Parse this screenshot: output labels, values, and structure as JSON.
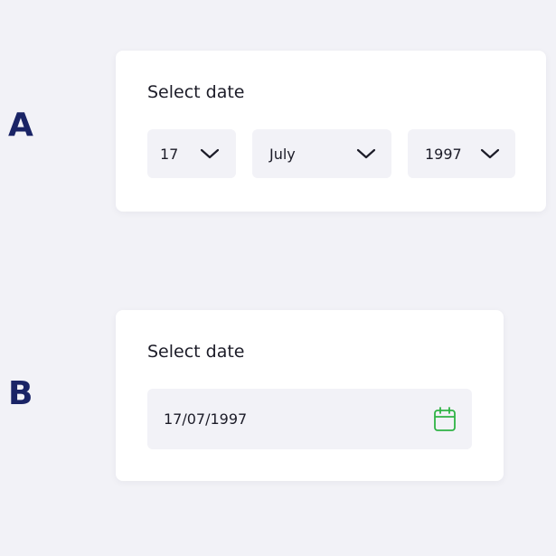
{
  "variants": {
    "a": {
      "letter": "A",
      "title": "Select date",
      "day": {
        "value": "17",
        "icon": "chevron-down-icon"
      },
      "month": {
        "value": "July",
        "icon": "chevron-down-icon"
      },
      "year": {
        "value": "1997",
        "icon": "chevron-down-icon"
      }
    },
    "b": {
      "letter": "B",
      "title": "Select date",
      "date_input": {
        "value": "17/07/1997",
        "icon": "calendar-icon"
      }
    }
  },
  "colors": {
    "background": "#f2f2f7",
    "card": "#ffffff",
    "letter": "#1a2466",
    "field": "#f2f2f7",
    "calendar_accent": "#2fb345"
  }
}
